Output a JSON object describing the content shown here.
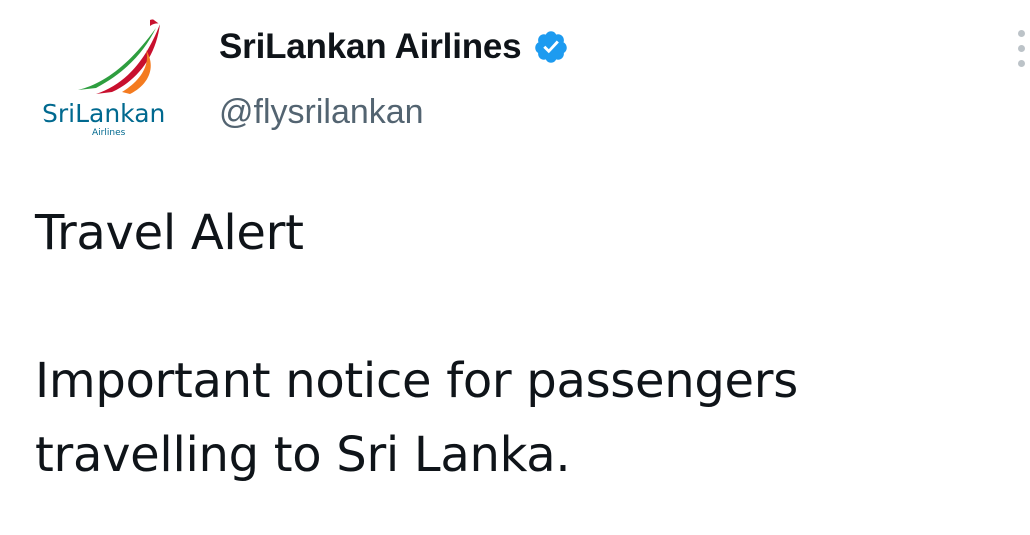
{
  "author": {
    "display_name": "SriLankan Airlines",
    "handle": "@flysrilankan",
    "verified": true,
    "avatar": {
      "icon": "srilankan-airlines-logo-icon",
      "logo_text": "SriLankan",
      "logo_subtext": "Airlines"
    }
  },
  "menu": {
    "icon": "more-options-icon"
  },
  "tweet": {
    "title_line": "Travel Alert",
    "body_line_1": "Important notice for passengers",
    "body_line_2": "travelling to Sri Lanka."
  },
  "colors": {
    "text": "#0f1419",
    "handle": "#536471",
    "verified_badge": "#1d9bf0",
    "logo_red": "#c8102e",
    "logo_green": "#2e9e3f",
    "logo_orange": "#f47b20",
    "logo_blue": "#00698f"
  }
}
